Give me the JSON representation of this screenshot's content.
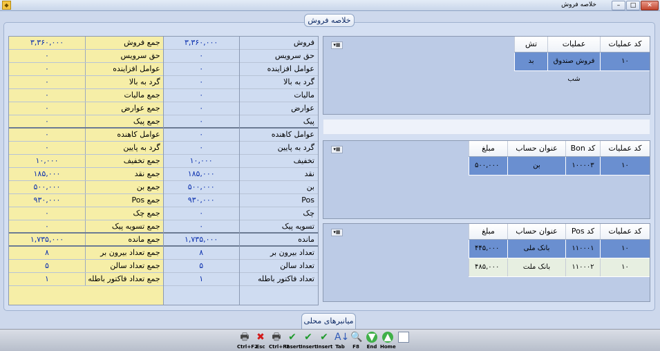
{
  "window": {
    "title": "خلاصه فروش",
    "controls": {
      "minimize": "–",
      "maximize": "□",
      "close": "✕"
    }
  },
  "frame_title": "خلاصه فروش",
  "summary": {
    "right_rows": [
      {
        "label": "فروش",
        "value": "۳,۳۶۰,۰۰۰"
      },
      {
        "label": "حق سرويس",
        "value": "۰"
      },
      {
        "label": "عوامل افزاينده",
        "value": "۰"
      },
      {
        "label": "گرد به بالا",
        "value": "۰"
      },
      {
        "label": "ماليات",
        "value": "۰"
      },
      {
        "label": "عوارض",
        "value": "۰"
      },
      {
        "label": "پيک",
        "value": "۰"
      },
      {
        "label": "عوامل کاهنده",
        "value": "۰"
      },
      {
        "label": "گرد به پايين",
        "value": "۰"
      },
      {
        "label": "تخفيف",
        "value": "۱۰,۰۰۰"
      },
      {
        "label": "نقد",
        "value": "۱۸۵,۰۰۰"
      },
      {
        "label": "بن",
        "value": "۵۰۰,۰۰۰"
      },
      {
        "label": "Pos",
        "value": "۹۳۰,۰۰۰"
      },
      {
        "label": "چک",
        "value": "۰"
      },
      {
        "label": "تسويه پيک",
        "value": "۰"
      },
      {
        "label": "مانده",
        "value": "۱,۷۳۵,۰۰۰"
      },
      {
        "label": "تعداد بيرون بر",
        "value": "۸"
      },
      {
        "label": "تعداد سالن",
        "value": "۵"
      },
      {
        "label": "تعداد فاکتور باطله",
        "value": "۱"
      }
    ],
    "left_rows": [
      {
        "label": "جمع فروش",
        "value": "۳,۳۶۰,۰۰۰"
      },
      {
        "label": "حق سرويس",
        "value": "۰"
      },
      {
        "label": "عوامل افزاينده",
        "value": "۰"
      },
      {
        "label": "گرد به بالا",
        "value": "۰"
      },
      {
        "label": "جمع ماليات",
        "value": "۰"
      },
      {
        "label": "جمع عوارض",
        "value": "۰"
      },
      {
        "label": "جمع پيک",
        "value": "۰"
      },
      {
        "label": "عوامل کاهنده",
        "value": "۰"
      },
      {
        "label": "گرد به پايين",
        "value": "۰"
      },
      {
        "label": "جمع تخفيف",
        "value": "۱۰,۰۰۰"
      },
      {
        "label": "جمع نقد",
        "value": "۱۸۵,۰۰۰"
      },
      {
        "label": "جمع بن",
        "value": "۵۰۰,۰۰۰"
      },
      {
        "label": "جمع Pos",
        "value": "۹۳۰,۰۰۰"
      },
      {
        "label": "جمع چک",
        "value": "۰"
      },
      {
        "label": "جمع تسويه پيک",
        "value": "۰"
      },
      {
        "label": "جمع مانده",
        "value": "۱,۷۳۵,۰۰۰"
      },
      {
        "label": "جمع تعداد بيرون بر",
        "value": "۸"
      },
      {
        "label": "جمع تعداد سالن",
        "value": "۵"
      },
      {
        "label": "جمع تعداد فاکتور باطله",
        "value": "۱"
      }
    ]
  },
  "ops_grid": {
    "headers": [
      "کد عمليات",
      "عمليات",
      "تش"
    ],
    "rows": [
      [
        "۱۰",
        "فروش صندوق شب",
        "بد"
      ]
    ]
  },
  "bon_grid": {
    "headers": [
      "کد عمليات",
      "کد Bon",
      "عنوان حساب",
      "مبلغ"
    ],
    "rows": [
      [
        "۱۰",
        "۱۰۰۰۰۳",
        "بن",
        "۵۰۰,۰۰۰"
      ]
    ]
  },
  "pos_grid": {
    "headers": [
      "کد عمليات",
      "کد Pos",
      "عنوان حساب",
      "مبلغ"
    ],
    "rows": [
      [
        "۱۰",
        "۱۱۰۰۰۱",
        "بانک ملی",
        "۴۴۵,۰۰۰"
      ],
      [
        "۱۰",
        "۱۱۰۰۰۲",
        "بانک ملت",
        "۴۸۵,۰۰۰"
      ]
    ]
  },
  "grid_menu_icon": "grid-options-icon",
  "tab_label": "ميانبرهای محلی",
  "toolbar": [
    {
      "icon": "printer-icon",
      "label": "Ctrl+F2"
    },
    {
      "icon": "close-x-icon",
      "label": "Esc"
    },
    {
      "icon": "printer-icon",
      "label": "Ctrl+F2"
    },
    {
      "icon": "insert-check-icon",
      "label": "Insert"
    },
    {
      "icon": "insert-check-icon",
      "label": "Insert"
    },
    {
      "icon": "insert-check-icon",
      "label": "Insert"
    },
    {
      "icon": "sort-az-icon",
      "label": "Tab"
    },
    {
      "icon": "search-icon",
      "label": "F8"
    },
    {
      "icon": "end-icon",
      "label": "End"
    },
    {
      "icon": "home-icon",
      "label": "Home"
    },
    {
      "icon": "grid-icon",
      "label": ""
    }
  ],
  "colors": {
    "selected_row": "#6a8fd0",
    "summary_yellow": "#f6eea7",
    "summary_blue": "#cfdcf1",
    "value_blue": "#0a2fae"
  }
}
